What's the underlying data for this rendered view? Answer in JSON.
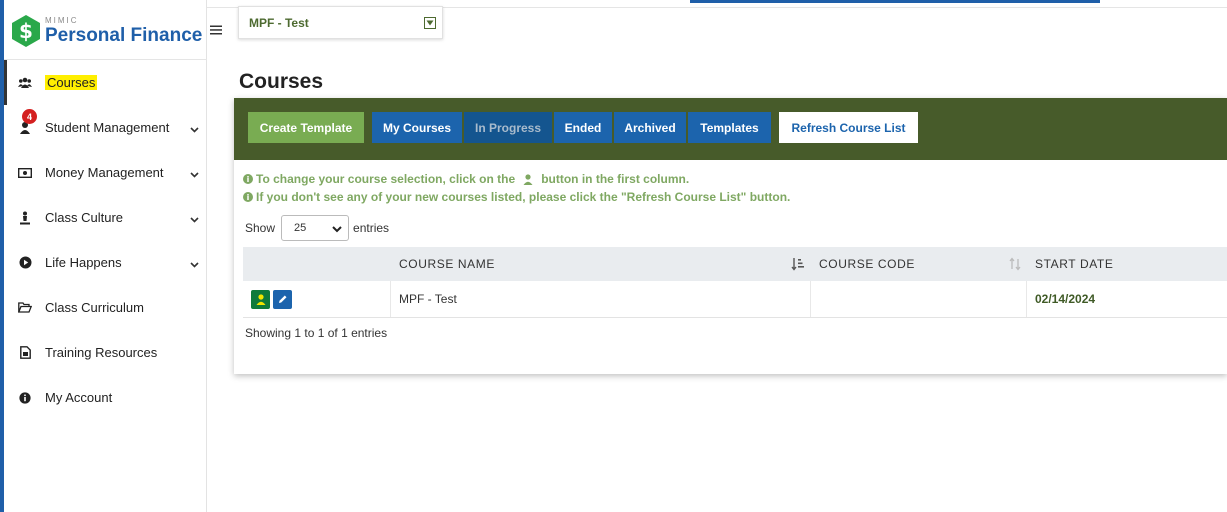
{
  "brand": {
    "small": "MIMIC",
    "name": "Personal Finance",
    "accent": "#1f5fa9",
    "logo_color": "#2aa84a",
    "logo_glyph": "$"
  },
  "sidebar": {
    "items": [
      {
        "label": "Courses",
        "icon": "users-icon"
      },
      {
        "label": "Student Management",
        "icon": "student-icon",
        "badge": "4"
      },
      {
        "label": "Money Management",
        "icon": "money-icon"
      },
      {
        "label": "Class Culture",
        "icon": "culture-icon"
      },
      {
        "label": "Life Happens",
        "icon": "play-circle-icon"
      },
      {
        "label": "Class Curriculum",
        "icon": "folder-open-icon"
      },
      {
        "label": "Training Resources",
        "icon": "document-icon"
      },
      {
        "label": "My Account",
        "icon": "info-circle-icon"
      }
    ]
  },
  "header": {
    "course_selector": "MPF - Test"
  },
  "page": {
    "title": "Courses"
  },
  "toolbar": {
    "create_label": "Create Template",
    "tabs": [
      {
        "label": "My Courses"
      },
      {
        "label": "In Progress"
      },
      {
        "label": "Ended"
      },
      {
        "label": "Archived"
      },
      {
        "label": "Templates"
      }
    ],
    "refresh_label": "Refresh Course List",
    "toolbar_color": "#475b2a",
    "tab_color": "#1c64ad"
  },
  "info": {
    "line1_pre": "To change your course selection, click on the",
    "line1_post": "button in the first column.",
    "line2": "If you don't see any of your new courses listed, please click the \"Refresh Course List\" button."
  },
  "entries": {
    "show_label": "Show",
    "page_size": "25",
    "entries_label": "entries"
  },
  "table": {
    "columns": [
      "",
      "COURSE NAME",
      "COURSE CODE",
      "START DATE"
    ],
    "rows": [
      {
        "course_name": "MPF - Test",
        "course_code": "",
        "start_date": "02/14/2024"
      }
    ]
  },
  "footer": {
    "showing": "Showing 1 to 1 of 1 entries"
  }
}
